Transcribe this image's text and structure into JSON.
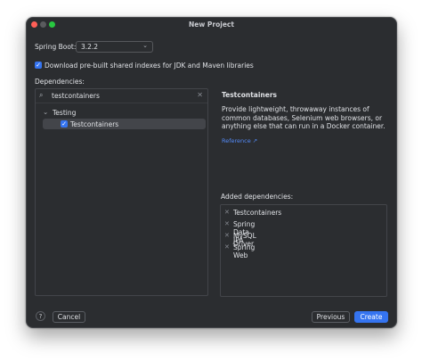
{
  "window": {
    "title": "New Project"
  },
  "spring_boot": {
    "label": "Spring Boot:",
    "version": "3.2.2"
  },
  "download_indexes": {
    "checked": true,
    "label": "Download pre-built shared indexes for JDK and Maven libraries"
  },
  "dependencies": {
    "label": "Dependencies:",
    "search_value": "testcontainers",
    "tree": {
      "group": "Testing",
      "items": [
        {
          "label": "Testcontainers",
          "checked": true,
          "selected": true
        }
      ]
    }
  },
  "detail": {
    "title": "Testcontainers",
    "description": "Provide lightweight, throwaway instances of common databases, Selenium web browsers, or anything else that can run in a Docker container.",
    "reference_link": "Reference ↗"
  },
  "added": {
    "label": "Added dependencies:",
    "items": [
      "Testcontainers",
      "Spring Data JPA",
      "MySQL Driver",
      "Spring Web"
    ]
  },
  "footer": {
    "help_label": "?",
    "cancel_label": "Cancel",
    "previous_label": "Previous",
    "create_label": "Create"
  },
  "icons": {
    "close": "traffic-light-close",
    "minimize": "traffic-light-minimize",
    "maximize": "traffic-light-maximize",
    "search": "search-icon",
    "clear": "clear-icon",
    "chevron": "chevron-down-icon",
    "remove": "remove-icon"
  },
  "colors": {
    "background": "#2b2d30",
    "accent": "#3574f0",
    "link": "#548af7",
    "text": "#dfe1e5"
  }
}
